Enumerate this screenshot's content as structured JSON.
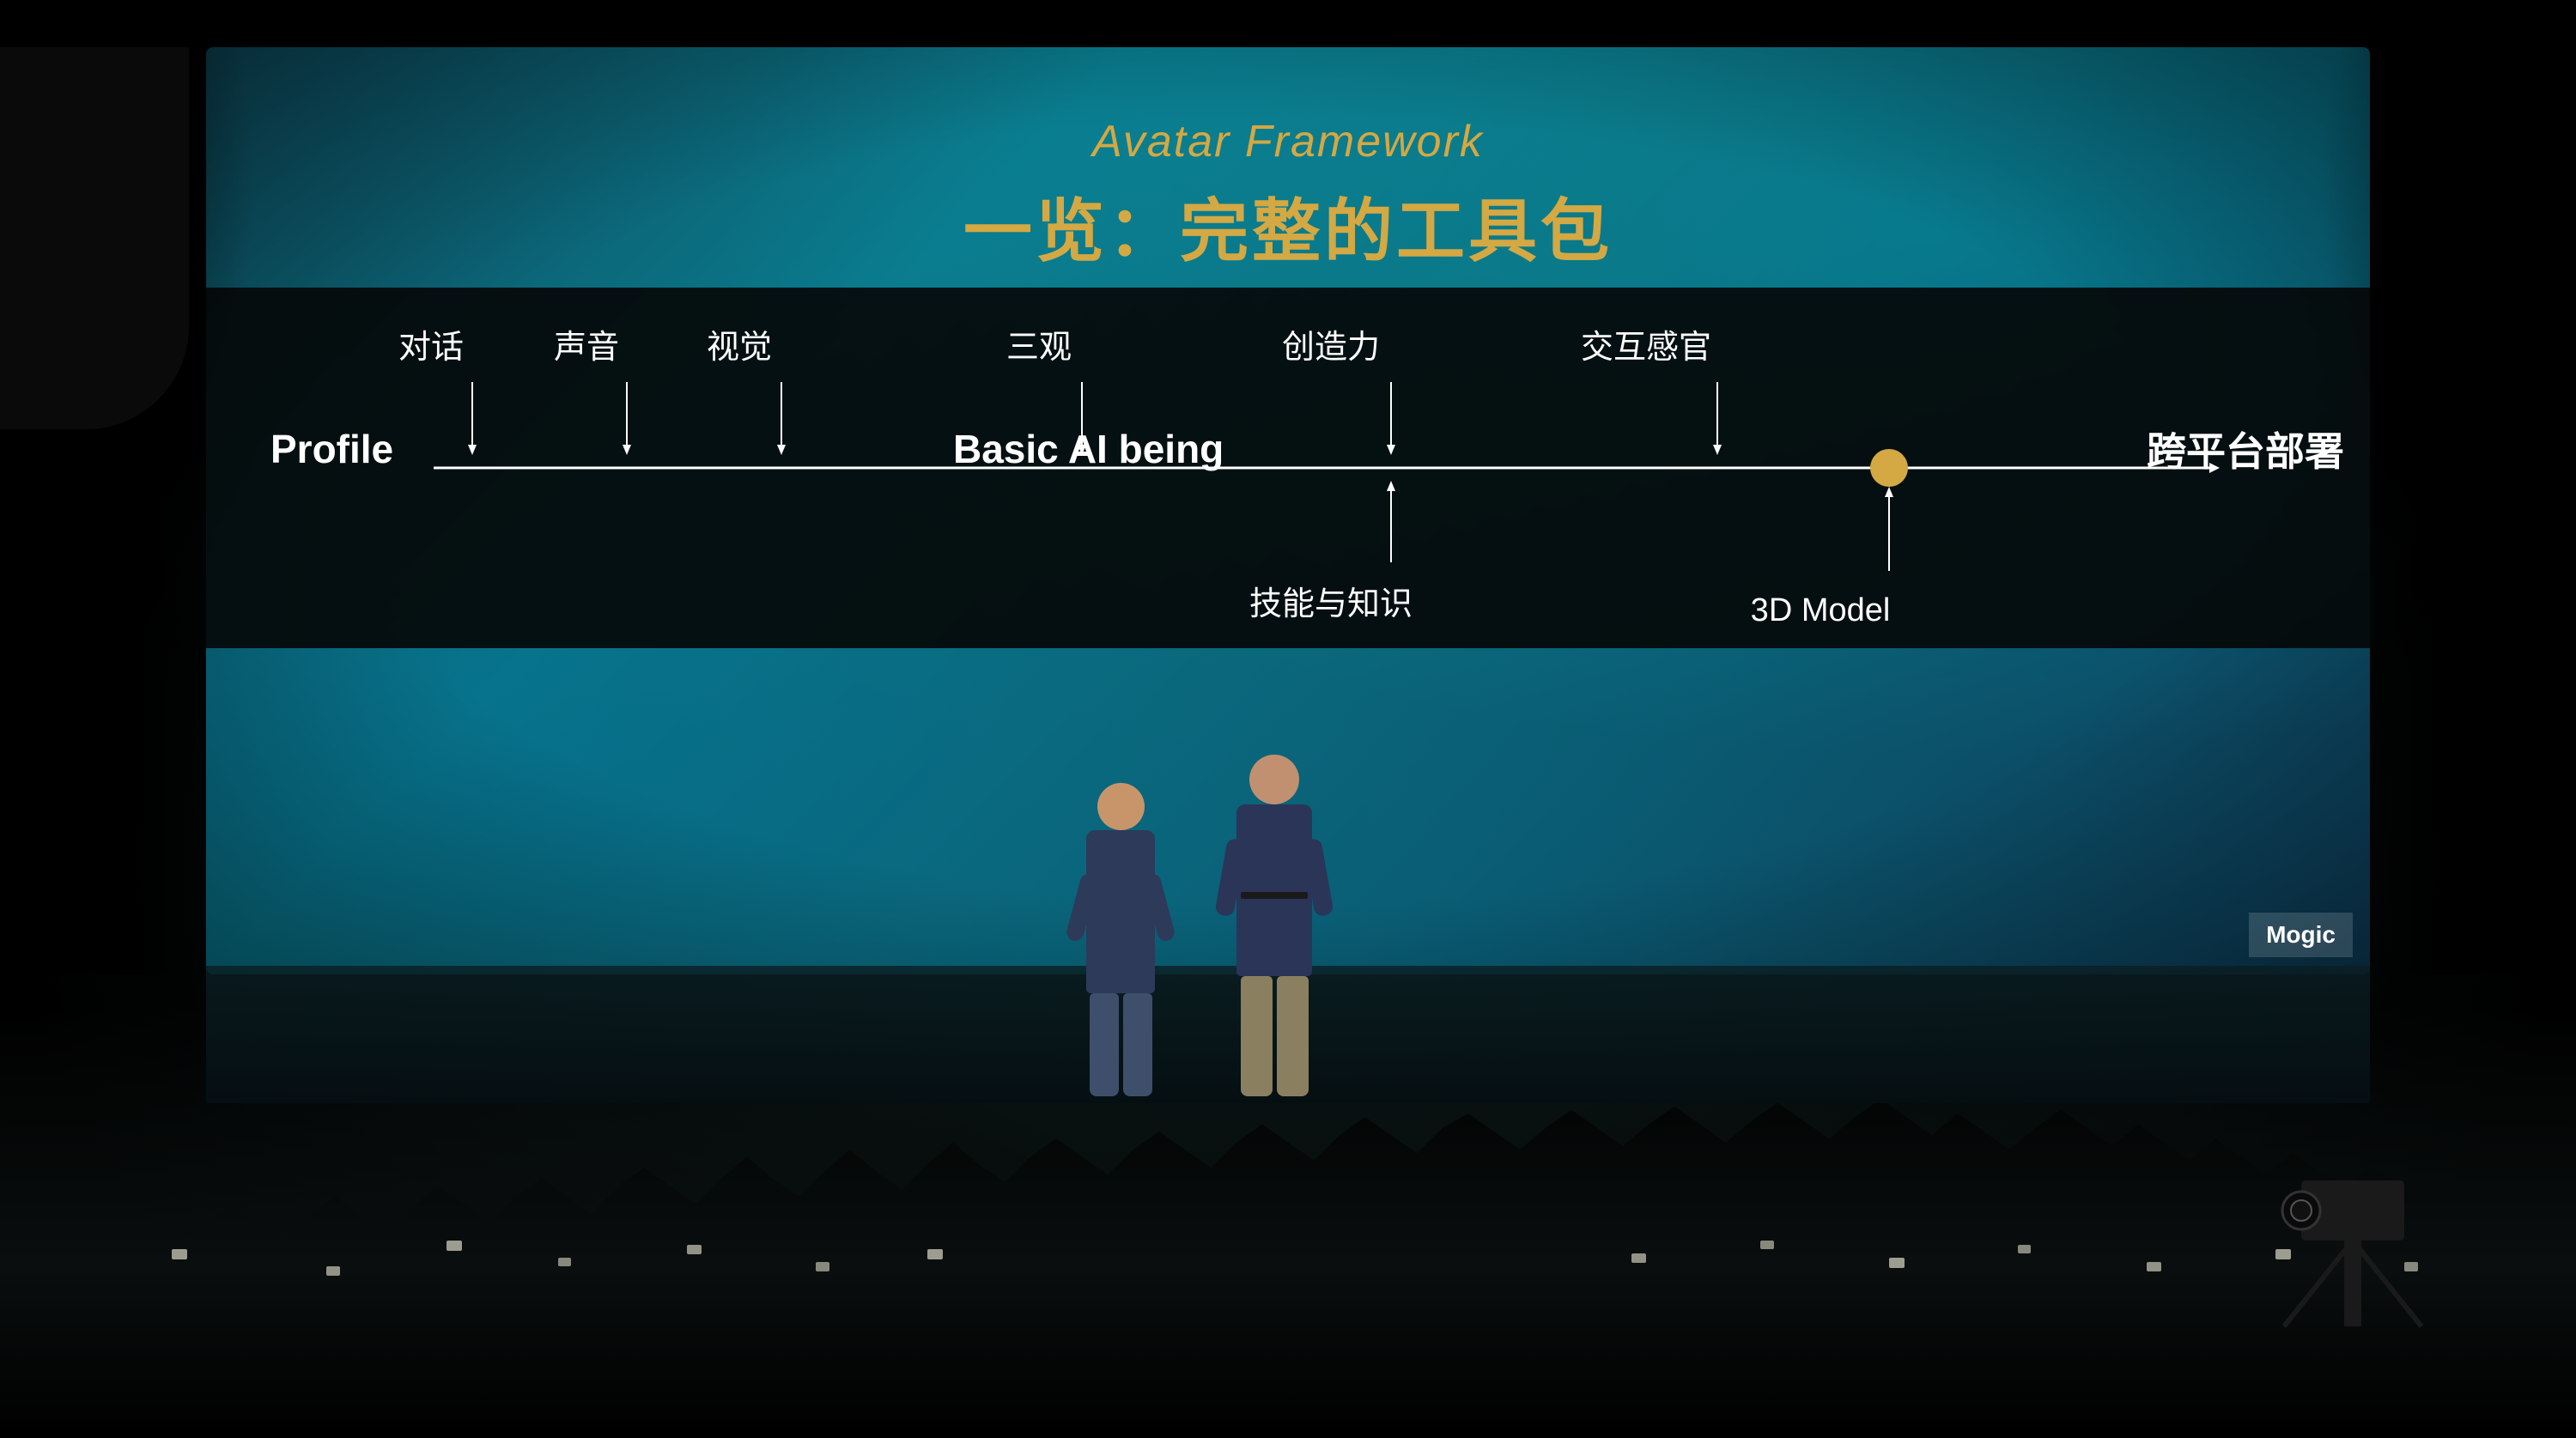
{
  "screen": {
    "title_english": "Avatar Framework",
    "title_chinese": "一览：完整的工具包",
    "diagram": {
      "profile_label": "Profile",
      "basic_ai_label": "Basic AI being",
      "cross_platform_label": "跨平台部署",
      "above_labels": [
        {
          "text": "对话",
          "position": 1
        },
        {
          "text": "声音",
          "position": 2
        },
        {
          "text": "视觉",
          "position": 3
        },
        {
          "text": "三观",
          "position": 4
        },
        {
          "text": "创造力",
          "position": 5
        },
        {
          "text": "交互感官",
          "position": 6
        }
      ],
      "below_labels": [
        {
          "text": "技能与知识",
          "arrow": "up"
        },
        {
          "text": "3D Model",
          "arrow": "up"
        }
      ]
    }
  },
  "corner_brand": "Mogic",
  "colors": {
    "gold": "#d4a843",
    "teal_bg": "#0a7a8c",
    "dark_banner": "#050808",
    "white": "#ffffff"
  }
}
